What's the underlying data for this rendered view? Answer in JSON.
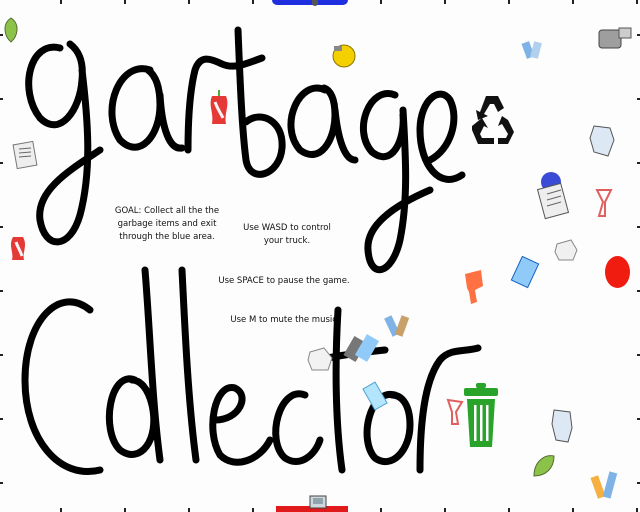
{
  "game": {
    "title_line1": "garbage",
    "title_line2": "Collector",
    "instructions": {
      "goal": "GOAL: Collect all the  the\ngarbage items and exit\nthrough the blue area.",
      "move": "Use WASD to control\nyour truck.",
      "pause": "Use SPACE to pause the game.",
      "mute": "Use M to mute the music."
    }
  },
  "icons": {
    "recycle": "recycle-icon",
    "trash_can": "green-trash-can-icon",
    "exit_zone": "blue-exit-zone",
    "truck": "garbage-truck-icon",
    "player_ball": "red-ball-player"
  },
  "colors": {
    "exit_blue": "#1f2fe0",
    "bottom_red": "#e01a1a",
    "trash_green": "#2aa32a",
    "player_red": "#f01c10",
    "ink": "#000000"
  }
}
